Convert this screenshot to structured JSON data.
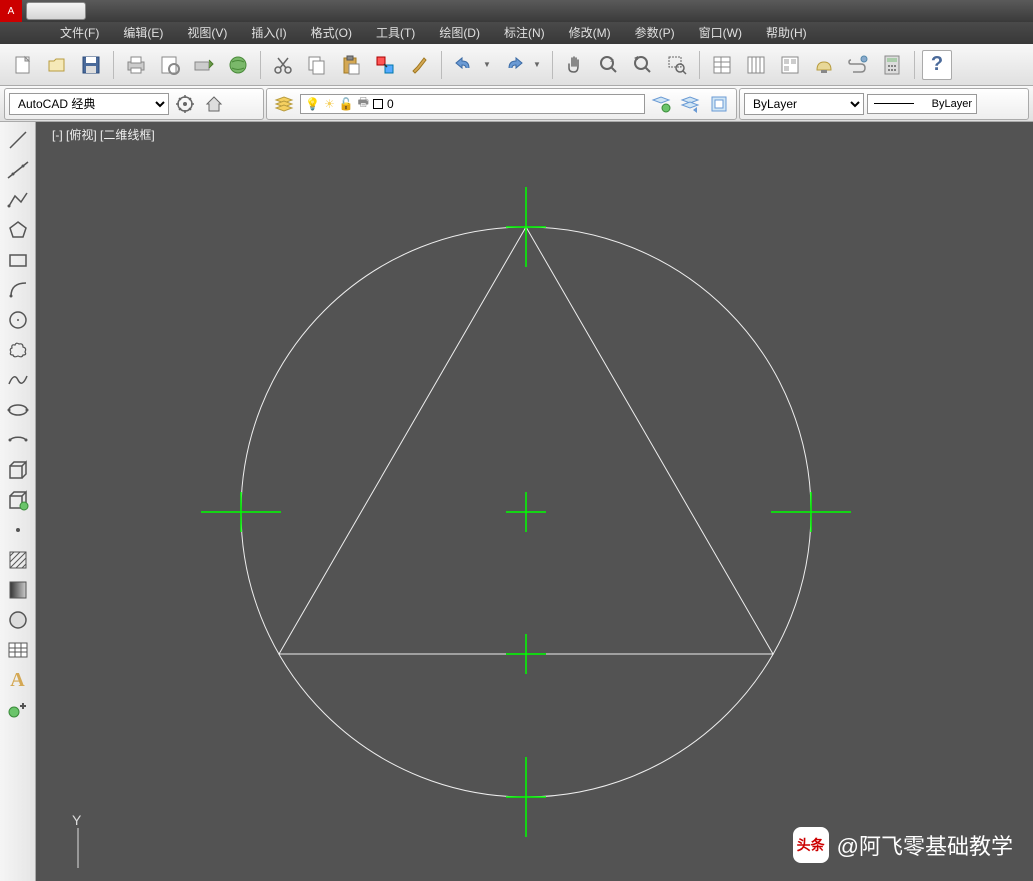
{
  "menus": [
    "文件(F)",
    "编辑(E)",
    "视图(V)",
    "插入(I)",
    "格式(O)",
    "工具(T)",
    "绘图(D)",
    "标注(N)",
    "修改(M)",
    "参数(P)",
    "窗口(W)",
    "帮助(H)"
  ],
  "toolbar1_icons": [
    "new",
    "open",
    "save",
    "sep",
    "print",
    "preview",
    "publish",
    "3dprint",
    "sep",
    "cut",
    "copy",
    "paste",
    "match",
    "brush",
    "sep",
    "undo",
    "dd",
    "redo",
    "dd",
    "sep",
    "pan",
    "zoom-realtime",
    "zoom-prev",
    "zoom-window",
    "sep",
    "props",
    "sheet",
    "tool-palette",
    "clean",
    "calc",
    "sep",
    "help"
  ],
  "workspace": {
    "label": "AutoCAD 经典"
  },
  "layer": {
    "value": "0",
    "bylayer": "ByLayer",
    "linetype": "ByLayer"
  },
  "viewport": {
    "label": "[-] [俯视] [二维线框]"
  },
  "watermark": {
    "brand": "头条",
    "author": "@阿飞零基础教学"
  },
  "ucs": {
    "y": "Y"
  },
  "draw_tools": [
    "line",
    "construction-line",
    "polyline",
    "polygon",
    "rectangle",
    "arc",
    "circle",
    "revision-cloud",
    "spline",
    "ellipse",
    "ellipse-arc",
    "insert-block",
    "make-block",
    "point",
    "hatch",
    "gradient",
    "region",
    "table",
    "text",
    "add-selected"
  ]
}
